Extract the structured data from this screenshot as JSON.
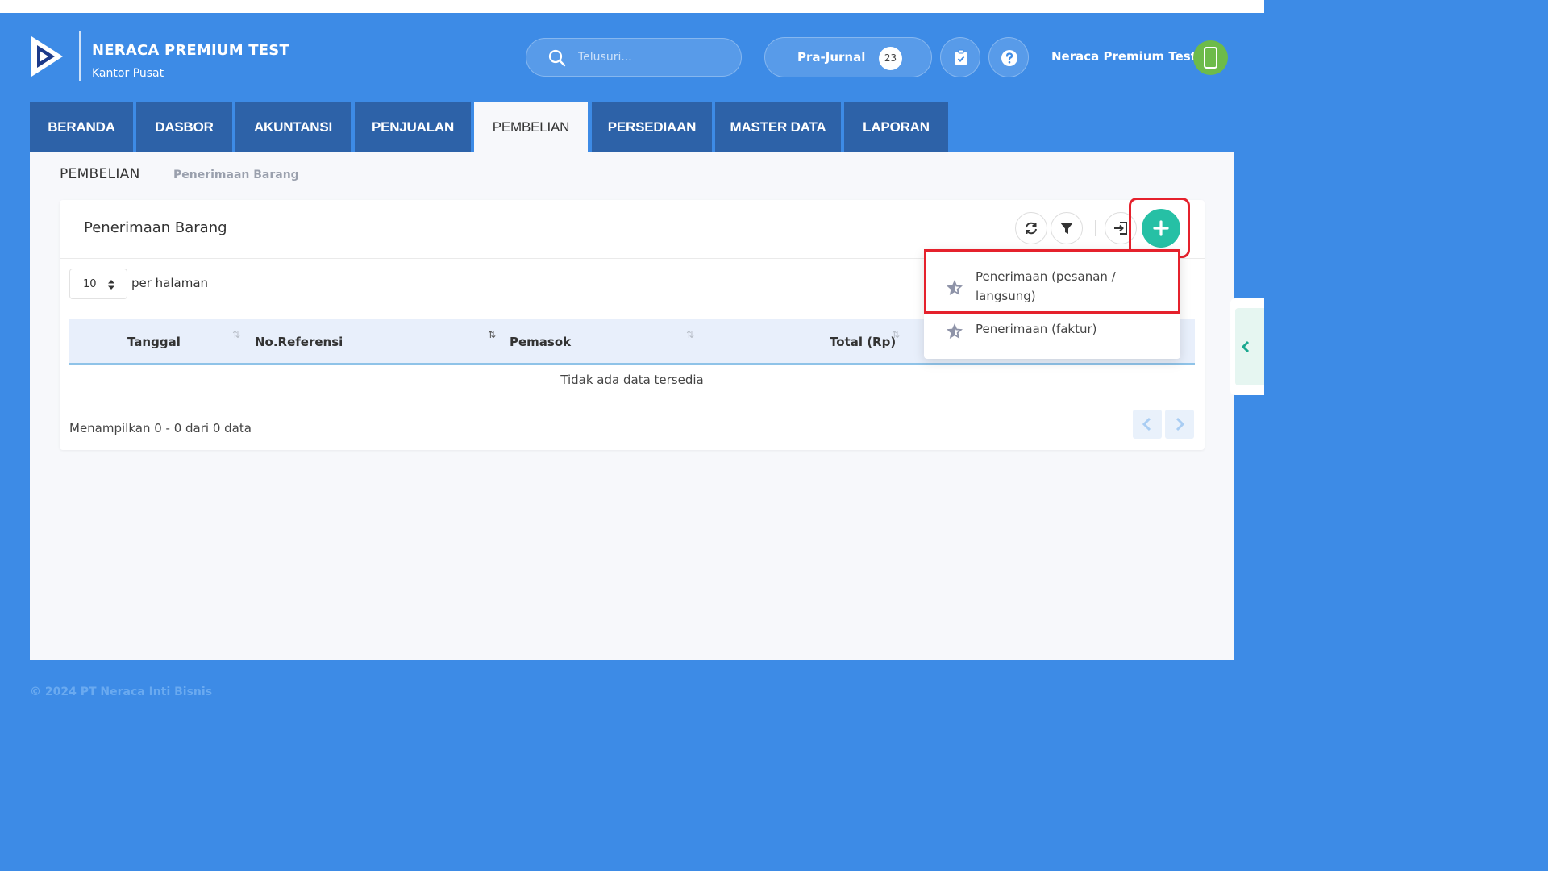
{
  "header": {
    "company_name": "NERACA PREMIUM TEST",
    "company_branch": "Kantor Pusat",
    "search_placeholder": "Telusuri...",
    "prajurnal_label": "Pra-Jurnal",
    "prajurnal_count": "23",
    "user_name": "Neraca Premium Test"
  },
  "tabs": [
    {
      "label": "BERANDA",
      "active": false
    },
    {
      "label": "DASBOR",
      "active": false
    },
    {
      "label": "AKUNTANSI",
      "active": false
    },
    {
      "label": "PENJUALAN",
      "active": false
    },
    {
      "label": "PEMBELIAN",
      "active": true
    },
    {
      "label": "PERSEDIAAN",
      "active": false
    },
    {
      "label": "MASTER DATA",
      "active": false
    },
    {
      "label": "LAPORAN",
      "active": false
    }
  ],
  "breadcrumb": {
    "section": "PEMBELIAN",
    "page": "Penerimaan Barang"
  },
  "card": {
    "title": "Penerimaan Barang",
    "per_page_value": "10",
    "per_page_label": "per halaman",
    "columns": [
      "Tanggal",
      "No.Referensi",
      "Pemasok",
      "Total (Rp)"
    ],
    "empty_message": "Tidak ada data tersedia",
    "summary": "Menampilkan 0 - 0 dari 0 data"
  },
  "add_menu": {
    "item1_line1": "Penerimaan (pesanan /",
    "item1_line2": "langsung)",
    "item2": "Penerimaan (faktur)"
  },
  "footer": {
    "copyright": "© 2024 PT Neraca Inti Bisnis"
  },
  "colors": {
    "brand_blue": "#3d8be6",
    "tab_dark": "#2d62a8",
    "accent_green": "#26c0a5",
    "highlight_red": "#e5212c"
  }
}
